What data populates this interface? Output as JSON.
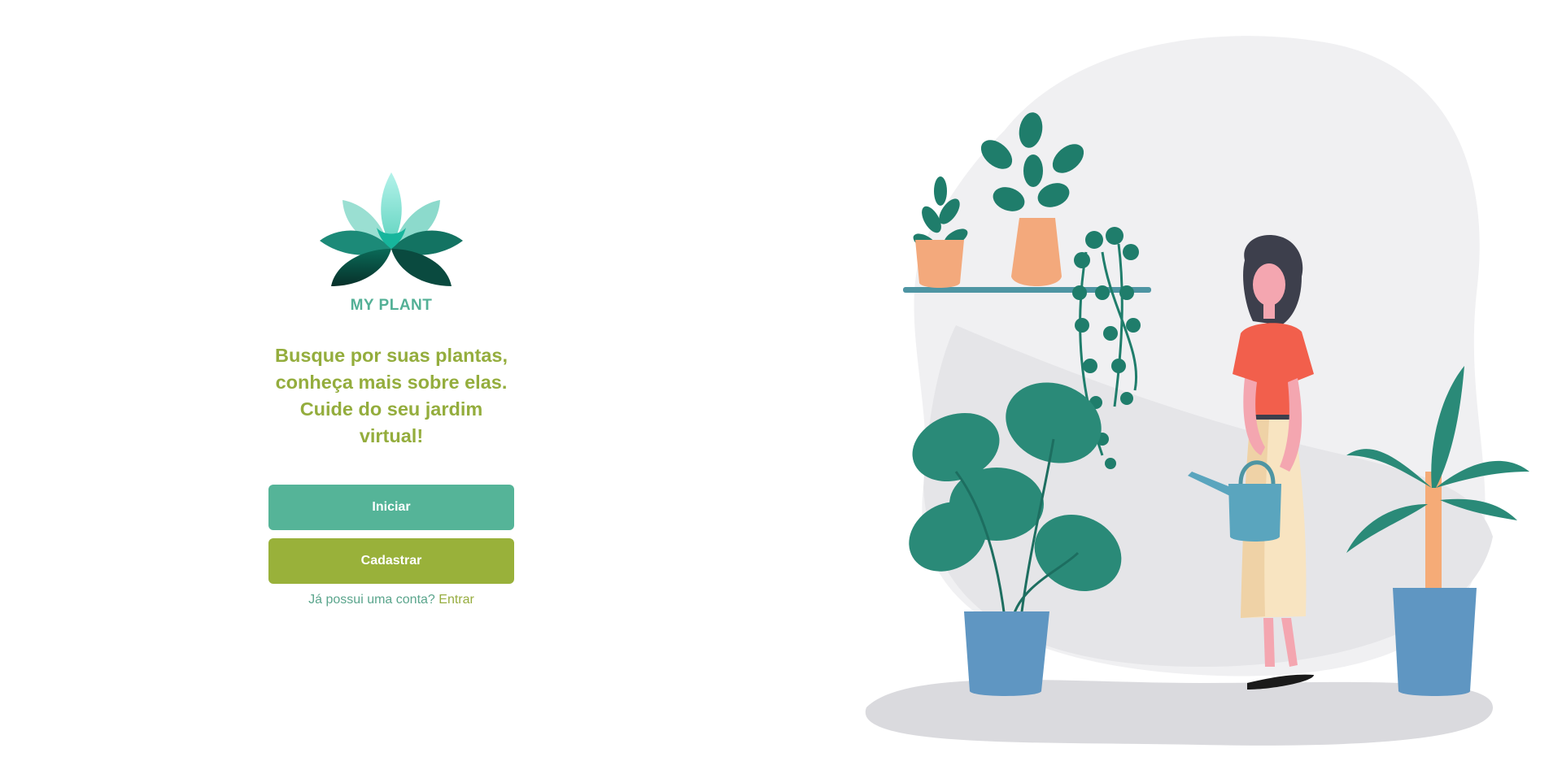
{
  "app": {
    "name": "MY PLANT",
    "tagline": "Busque por suas plantas, conheça mais sobre elas. Cuide do seu jardim virtual!"
  },
  "actions": {
    "start_label": "Iniciar",
    "register_label": "Cadastrar"
  },
  "login": {
    "question": "Já possui uma conta?",
    "link_label": "Entrar"
  },
  "icons": {
    "logo": "lotus-icon",
    "illustration": "woman-watering-plants-illustration"
  },
  "colors": {
    "brand_green": "#53b096",
    "accent_olive": "#99b13a",
    "tagline": "#94ad3d"
  }
}
